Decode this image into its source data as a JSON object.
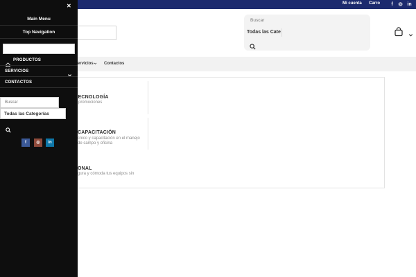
{
  "topbar": {
    "account_label": "Mi cuenta",
    "cart_label": "Carro",
    "social": [
      {
        "icon": "facebook-icon",
        "glyph": "f"
      },
      {
        "icon": "instagram-icon",
        "glyph": "◎"
      }
    ]
  },
  "header": {
    "search_placeholder": "Buscar",
    "category_label": "Todas las Cate"
  },
  "nav": {
    "servicios_label": "ervicios",
    "contactos_label": "Contactos"
  },
  "panel": {
    "items": [
      {
        "title": "TECNOLOGÍA",
        "desc": "e promociones"
      },
      {
        "title": "CAPACITACIÓN",
        "desc_line1": "cnico y capacitación en el manejo",
        "desc_line2": "de campo y oficina"
      },
      {
        "title": "ONAL",
        "desc": "gura y cómoda tus equipos sin"
      }
    ]
  },
  "drawer": {
    "main_menu_label": "Main Menu",
    "top_navigation_label": "Top Navigation",
    "menu": [
      {
        "label": "PRODUCTOS"
      },
      {
        "label": "SERVICIOS"
      },
      {
        "label": "CONTACTOS"
      }
    ],
    "search_placeholder": "Buscar",
    "category_label": "Todas las Categorías",
    "social": [
      {
        "icon": "facebook-icon",
        "glyph": "f",
        "color": "#3b5998"
      },
      {
        "icon": "instagram-icon",
        "glyph": "◎",
        "color": "#8a3ab9"
      },
      {
        "icon": "linkedin-icon",
        "glyph": "in",
        "color": "#0e76a8"
      }
    ]
  },
  "colors": {
    "topbar": "#1c2a6e",
    "drawer": "#0e0e0e"
  }
}
